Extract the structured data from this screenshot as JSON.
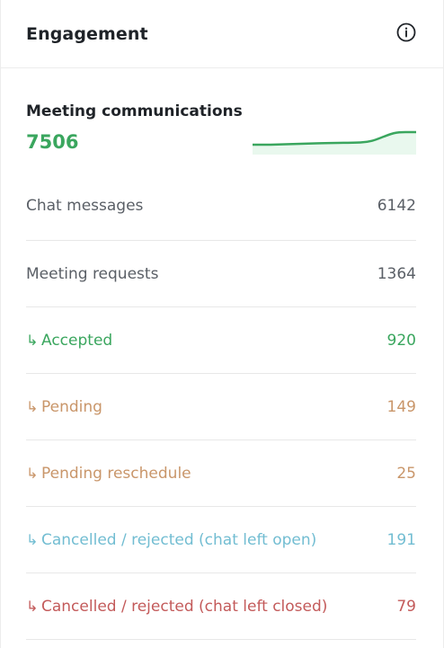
{
  "header": {
    "title": "Engagement",
    "info_icon": "info-circle-icon"
  },
  "summary": {
    "label": "Meeting communications",
    "value": "7506",
    "trend_icon": "sparkline"
  },
  "rows": [
    {
      "label": "Chat messages",
      "value": "6142",
      "arrow": "",
      "tone": "default"
    },
    {
      "label": "Meeting requests",
      "value": "1364",
      "arrow": "",
      "tone": "default"
    },
    {
      "label": "Accepted",
      "value": "920",
      "arrow": "↳",
      "tone": "green"
    },
    {
      "label": "Pending",
      "value": "149",
      "arrow": "↳",
      "tone": "orange"
    },
    {
      "label": "Pending reschedule",
      "value": "25",
      "arrow": "↳",
      "tone": "orange"
    },
    {
      "label": "Cancelled / rejected (chat left open)",
      "value": "191",
      "arrow": "↳",
      "tone": "blue"
    },
    {
      "label": "Cancelled / rejected (chat left closed)",
      "value": "79",
      "arrow": "↳",
      "tone": "red"
    }
  ],
  "colors": {
    "green": "#3aa65e",
    "orange": "#c9966a",
    "blue": "#72bdd2",
    "red": "#c35a5a",
    "default": "#5a5f66"
  }
}
